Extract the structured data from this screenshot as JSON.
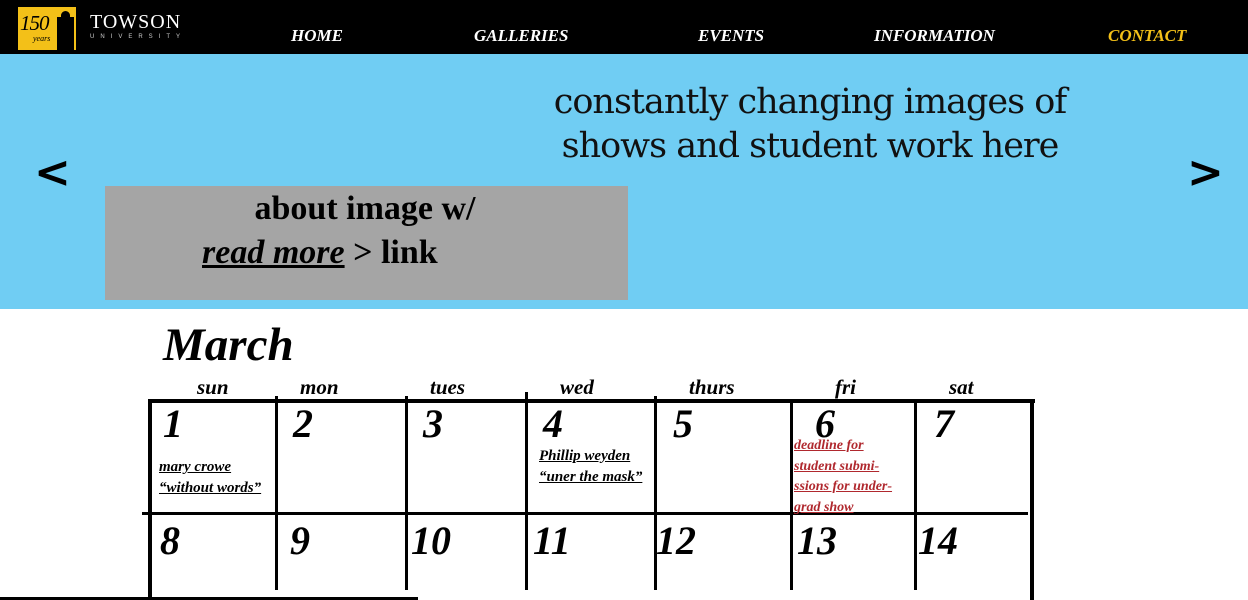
{
  "header": {
    "logo_number": "150",
    "logo_years": "years",
    "wordmark": "TOWSON",
    "wordmark_sub": "UNIVERSITY",
    "nav": [
      {
        "label": "HOME"
      },
      {
        "label": "GALLERIES"
      },
      {
        "label": "EVENTS"
      },
      {
        "label": "INFORMATION"
      },
      {
        "label": "CONTACT",
        "active": true
      }
    ],
    "colors": {
      "bar": "#000000",
      "accent": "#f3c018"
    }
  },
  "hero": {
    "line1": "constantly changing images of",
    "line2": "shows and student work here",
    "prev_arrow": "<",
    "next_arrow": ">",
    "about_line1": "about image w/",
    "read_more": "read more",
    "about_suffix": " > link",
    "background": "#70cdf3"
  },
  "calendar": {
    "month": "March",
    "days_of_week": [
      "sun",
      "mon",
      "tues",
      "wed",
      "thurs",
      "fri",
      "sat"
    ],
    "week1": [
      "1",
      "2",
      "3",
      "4",
      "5",
      "6",
      "7"
    ],
    "week2": [
      "8",
      "9",
      "10",
      "11",
      "12",
      "13",
      "14"
    ],
    "events": {
      "sun_1": [
        "mary crowe",
        "“without words”"
      ],
      "wed_4": [
        "Phillip weyden",
        "“uner the mask”"
      ],
      "fri_6": [
        "deadline for",
        "student submi-",
        "ssions for under-",
        "grad show"
      ]
    }
  }
}
